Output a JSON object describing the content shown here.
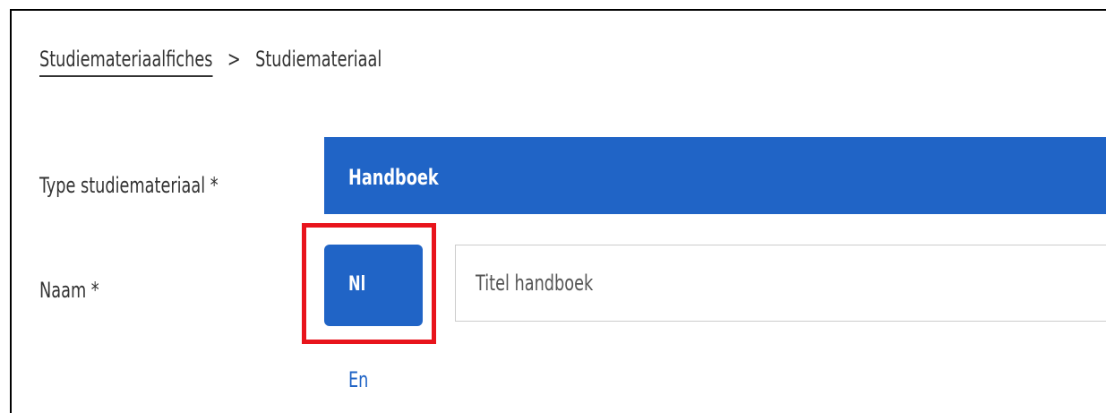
{
  "breadcrumb": {
    "parent": "Studiemateriaalfiches",
    "separator": ">",
    "current": "Studiemateriaal"
  },
  "form": {
    "type_label": "Type studiemateriaal *",
    "type_value": "Handboek",
    "name_label": "Naam *",
    "languages": [
      "Nl",
      "En"
    ],
    "title_placeholder": "Titel handboek"
  },
  "colors": {
    "primary": "#2064c6",
    "highlight": "#e8141c",
    "text": "#333333"
  }
}
